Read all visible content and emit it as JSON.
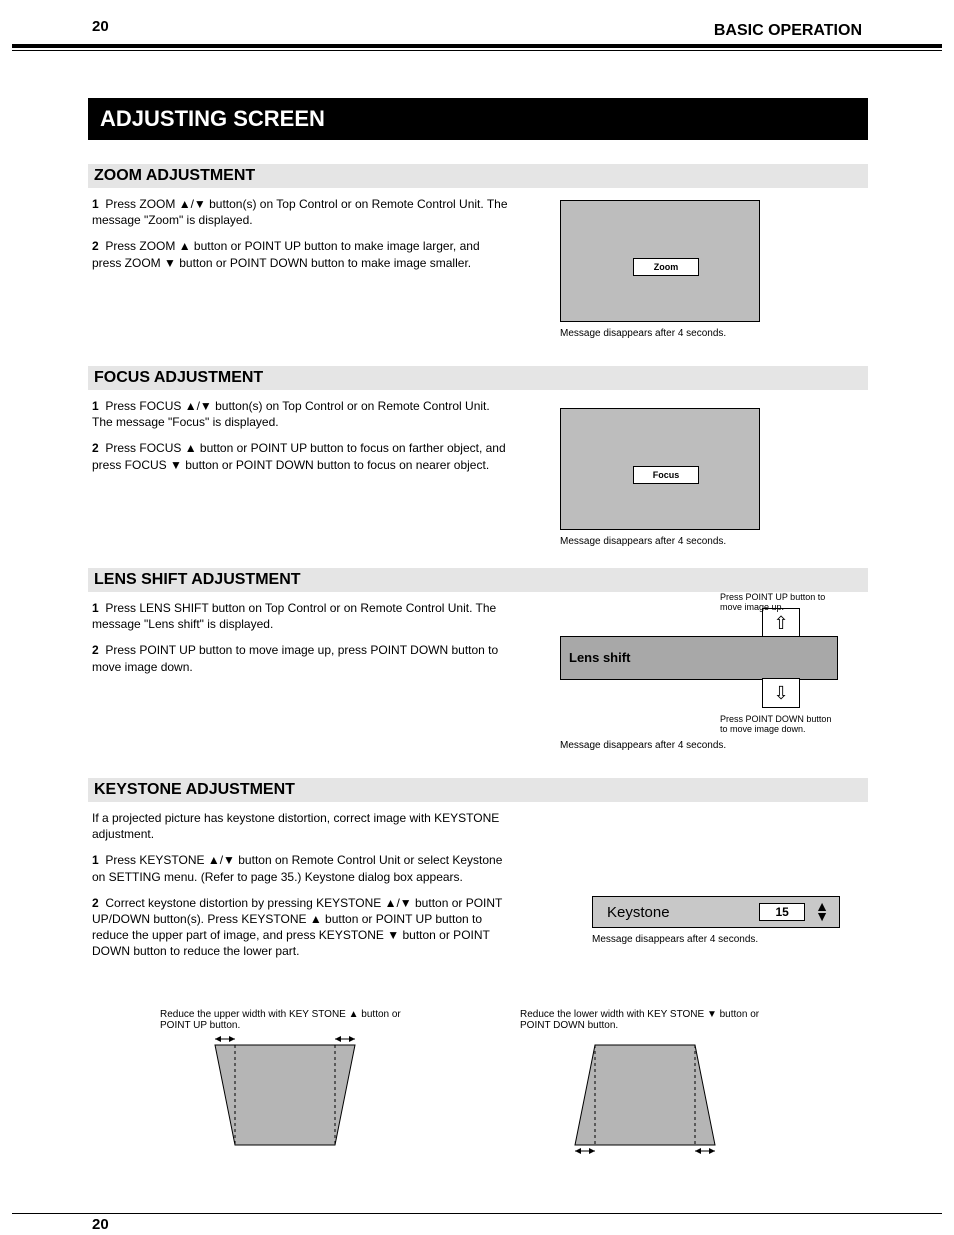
{
  "pageNumber": "20",
  "header": {
    "title": "BASIC OPERATION"
  },
  "sections": {
    "banner": "ADJUSTING SCREEN",
    "zoom": {
      "title": "ZOOM ADJUSTMENT",
      "body": "Press ZOOM ▲/▼ button(s) on Top Control or on Remote Control Unit. The message \"Zoom\" is displayed.",
      "body2": "Press ZOOM ▲ button or POINT UP button to make image larger, and press ZOOM ▼ button or POINT DOWN button to make image smaller.",
      "osd": "Zoom",
      "caption": "Message disappears after 4 seconds."
    },
    "focus": {
      "title": "FOCUS ADJUSTMENT",
      "body": "Press FOCUS ▲/▼ button(s) on Top Control or on Remote Control Unit. The message \"Focus\" is displayed.",
      "body2": "Press FOCUS ▲ button or POINT UP button to focus on farther object, and press FOCUS ▼ button or POINT DOWN button to focus on nearer object.",
      "osd": "Focus",
      "caption": "Message disappears after 4 seconds."
    },
    "lensshift": {
      "title": "LENS SHIFT ADJUSTMENT",
      "body": "Press LENS SHIFT button on Top Control or on Remote Control Unit. The message \"Lens shift\" is displayed.",
      "body2": "Press POINT UP button to move image up, press POINT DOWN button to move image down.",
      "osd": "Lens shift",
      "upLabel": "Press POINT UP button to move image up.",
      "downLabel": "Press POINT DOWN button to move image down.",
      "caption": "Message disappears after 4 seconds."
    },
    "keystone": {
      "title": "KEYSTONE ADJUSTMENT",
      "intro": "If a projected picture has keystone distortion, correct image with KEYSTONE adjustment.",
      "step1": "Press KEYSTONE ▲/▼ button on Remote Control Unit or select Keystone on SETTING menu. (Refer to page 35.) Keystone dialog box appears.",
      "step2": "Correct keystone distortion by pressing KEYSTONE ▲/▼ button or POINT UP/DOWN button(s). Press KEYSTONE ▲ button or POINT UP button to reduce the upper part of image, and press KEYSTONE ▼ button or POINT DOWN button to reduce the lower part.",
      "osdLabel": "Keystone",
      "osdValue": "15",
      "caption": "Message disappears after 4 seconds.",
      "leftCap": "Reduce the upper width with KEY STONE ▲ button or POINT UP button.",
      "rightCap": "Reduce the lower width with KEY STONE ▼ button or POINT DOWN button."
    }
  }
}
